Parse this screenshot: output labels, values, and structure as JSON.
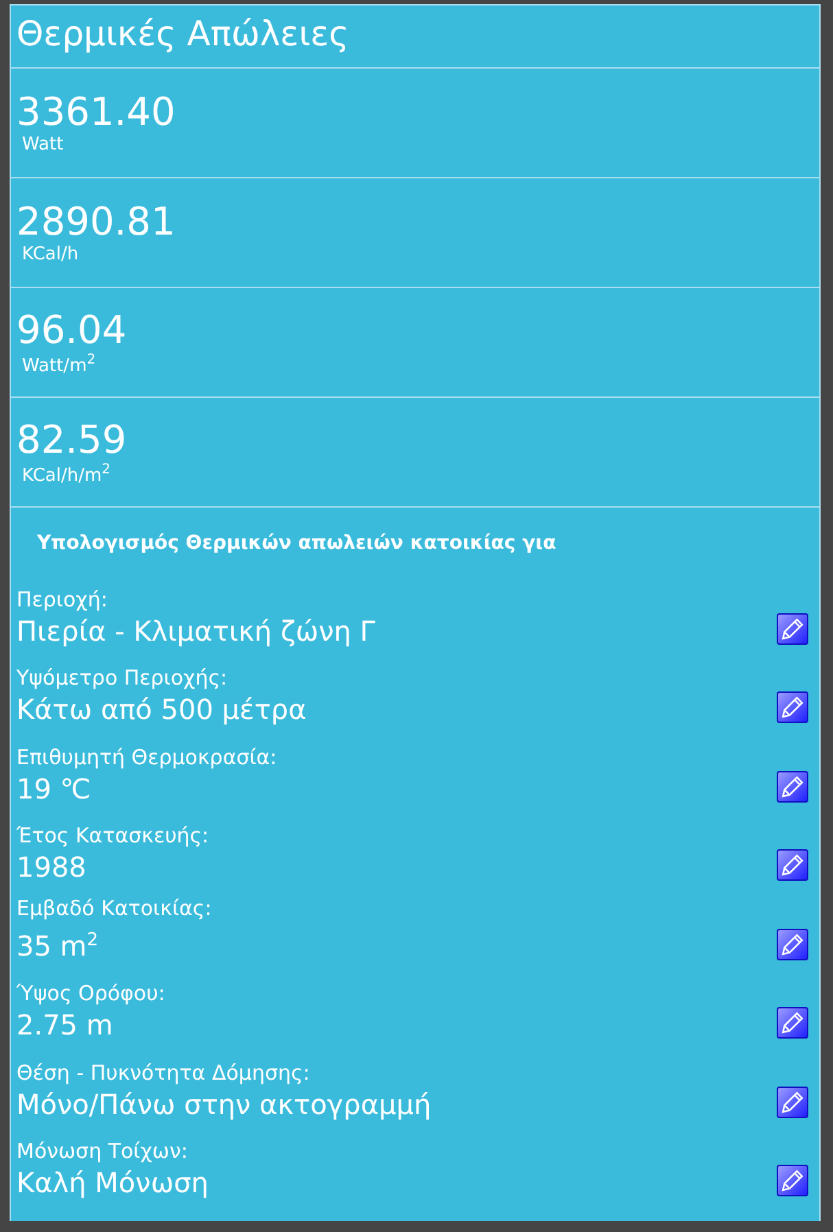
{
  "title": "Θερμικές Απώλειες",
  "results": [
    {
      "value": "3361.40",
      "unit": "Watt"
    },
    {
      "value": "2890.81",
      "unit": "KCal/h"
    },
    {
      "value": "96.04",
      "unit": "Watt/m$^{2}$"
    },
    {
      "value": "82.59",
      "unit": "KCal/h/m$^{2}$"
    }
  ],
  "section_heading": "Υπολογισμός Θερμικών απωλειών κατοικίας για",
  "fields": [
    {
      "label": "Περιοχή:",
      "value": "Πιερία - Κλιματική ζώνη Γ"
    },
    {
      "label": "Υψόμετρο Περιοχής:",
      "value": "Κάτω από 500 μέτρα"
    },
    {
      "label": "Επιθυμητή Θερμοκρασία:",
      "value": "19 ℃"
    },
    {
      "label": "Έτος Κατασκευής:",
      "value": "1988"
    },
    {
      "label": "Εμβαδό Κατοικίας:",
      "value": "35 m$^{2}$"
    },
    {
      "label": "Ύψος Ορόφου:",
      "value": "2.75 m"
    },
    {
      "label": "Θέση - Πυκνότητα Δόμησης:",
      "value": "Μόνο/Πάνω στην ακτογραμμή"
    },
    {
      "label": "Μόνωση Τοίχων:",
      "value": "Καλή Μόνωση"
    }
  ]
}
